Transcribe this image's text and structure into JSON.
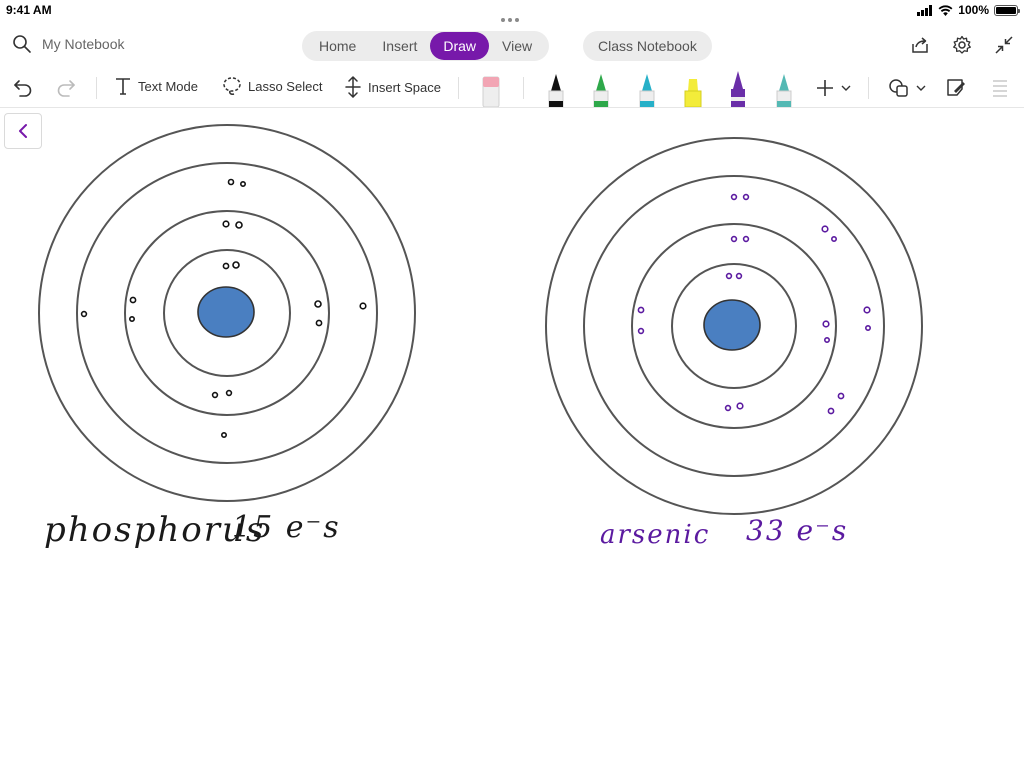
{
  "status": {
    "time": "9:41 AM",
    "battery_pct": "100%"
  },
  "search": {
    "notebook_name": "My Notebook"
  },
  "tabs": [
    {
      "label": "Home"
    },
    {
      "label": "Insert"
    },
    {
      "label": "Draw"
    },
    {
      "label": "View"
    }
  ],
  "active_tab": "Draw",
  "class_notebook_label": "Class Notebook",
  "toolbar": {
    "text_mode": "Text Mode",
    "lasso_select": "Lasso Select",
    "insert_space": "Insert Space"
  },
  "pens": [
    {
      "name": "eraser",
      "color": "#f2a5b4"
    },
    {
      "name": "black-pen",
      "color": "#111111"
    },
    {
      "name": "green-pen",
      "color": "#2ea84a"
    },
    {
      "name": "teal-pen",
      "color": "#27b0c8"
    },
    {
      "name": "yellow-highlighter",
      "color": "#f3ec3a"
    },
    {
      "name": "purple-pen",
      "color": "#6a2ea8"
    },
    {
      "name": "light-teal-pen",
      "color": "#54b9b4"
    }
  ],
  "accent_color": "#7719aa",
  "nucleus_color": "#4a7fc1",
  "ink": {
    "phosphorus_label": "phosphorus",
    "phosphorus_count": "15 e⁻s",
    "arsenic_label": "arsenic",
    "arsenic_count": "33 e⁻s"
  }
}
